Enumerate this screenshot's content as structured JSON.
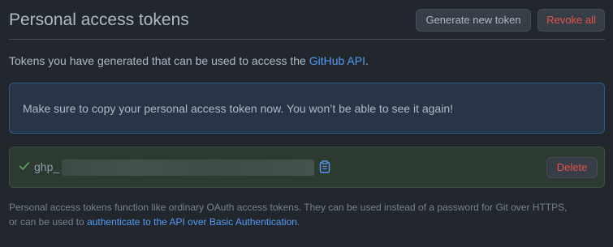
{
  "header": {
    "title": "Personal access tokens",
    "generate_label": "Generate new token",
    "revoke_label": "Revoke all"
  },
  "intro": {
    "text": "Tokens you have generated that can be used to access the ",
    "link": "GitHub API",
    "suffix": "."
  },
  "notice": {
    "text": "Make sure to copy your personal access token now. You won’t be able to see it again!"
  },
  "token": {
    "prefix": "ghp_",
    "status_icon": "check-icon",
    "copy_icon": "clipboard-icon",
    "delete_label": "Delete"
  },
  "footnote": {
    "line1": "Personal access tokens function like ordinary OAuth access tokens. They can be used instead of a password for Git over HTTPS,",
    "line2_prefix": "or can be used to ",
    "line2_link": "authenticate to the API over Basic Authentication",
    "line2_suffix": "."
  },
  "colors": {
    "background": "#22272e",
    "text": "#adbac7",
    "link": "#539bf5",
    "danger": "#e5534b",
    "success": "#57ab5a",
    "notice_border": "#2e5a8c",
    "notice_bg": "#283547",
    "token_bg": "#2d3a31"
  }
}
